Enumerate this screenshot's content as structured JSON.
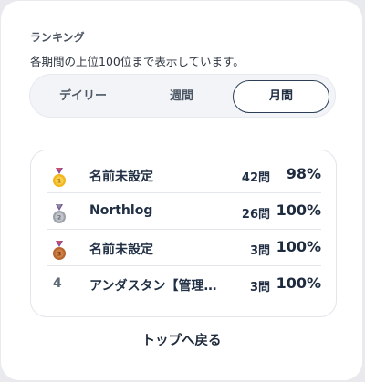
{
  "ranking": {
    "title": "ランキング",
    "description": "各期間の上位100位まで表示しています。",
    "tabs": [
      {
        "label": "デイリー",
        "selected": false
      },
      {
        "label": "週間",
        "selected": false
      },
      {
        "label": "月間",
        "selected": true
      }
    ],
    "rows": [
      {
        "rank": "1",
        "medal": "gold-medal-icon",
        "name": "名前未設定",
        "count": "42問",
        "rate": "98%"
      },
      {
        "rank": "2",
        "medal": "silver-medal-icon",
        "name": "Northlog",
        "count": "26問",
        "rate": "100%"
      },
      {
        "rank": "3",
        "medal": "bronze-medal-icon",
        "name": "名前未設定",
        "count": "3問",
        "rate": "100%"
      },
      {
        "rank": "4",
        "name": "アンダスタン【管理…",
        "count": "3問",
        "rate": "100%"
      }
    ],
    "colors": {
      "gold": "#f2b51c",
      "silver": "#9ea3ab",
      "bronze": "#b8652e",
      "ribbon": "#7a4aa0",
      "accent_border": "#2c3e57"
    }
  },
  "footer": {
    "home_link": "トップへ戻る"
  }
}
